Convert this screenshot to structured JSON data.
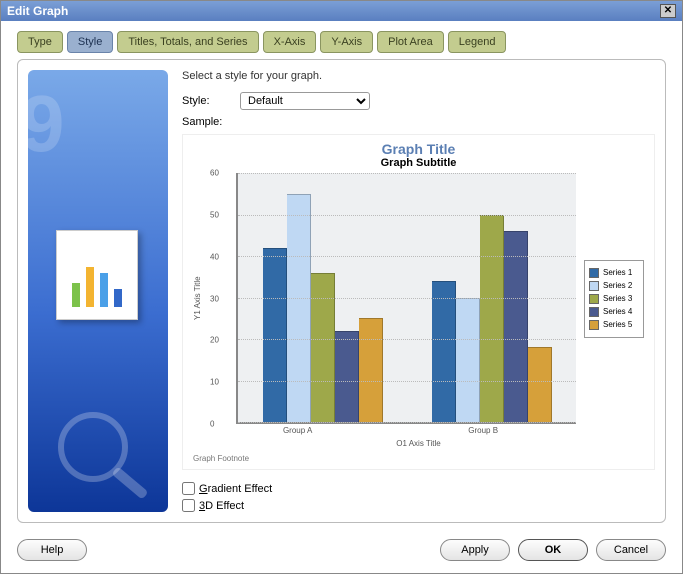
{
  "window": {
    "title": "Edit Graph"
  },
  "tabs": [
    {
      "label": "Type"
    },
    {
      "label": "Style"
    },
    {
      "label": "Titles, Totals, and Series"
    },
    {
      "label": "X-Axis"
    },
    {
      "label": "Y-Axis"
    },
    {
      "label": "Plot Area"
    },
    {
      "label": "Legend"
    }
  ],
  "active_tab_index": 1,
  "instruction": "Select a style for your graph.",
  "style_label": "Style:",
  "style_value": "Default",
  "sample_label": "Sample:",
  "checkboxes": {
    "gradient": "Gradient Effect",
    "threeD": "3D Effect"
  },
  "buttons": {
    "help": "Help",
    "apply": "Apply",
    "ok": "OK",
    "cancel": "Cancel"
  },
  "chart_data": {
    "type": "bar",
    "title": "Graph Title",
    "subtitle": "Graph Subtitle",
    "xlabel": "O1 Axis Title",
    "ylabel": "Y1 Axis Title",
    "footnote": "Graph Footnote",
    "ylim": [
      0,
      60
    ],
    "yticks": [
      0,
      10,
      20,
      30,
      40,
      50,
      60
    ],
    "categories": [
      "Group A",
      "Group B"
    ],
    "series": [
      {
        "name": "Series 1",
        "color": "#316aa6",
        "values": [
          42,
          34
        ]
      },
      {
        "name": "Series 2",
        "color": "#bfd8f3",
        "values": [
          55,
          30
        ]
      },
      {
        "name": "Series 3",
        "color": "#9ea84a",
        "values": [
          36,
          50
        ]
      },
      {
        "name": "Series 4",
        "color": "#4a5a8f",
        "values": [
          22,
          46
        ]
      },
      {
        "name": "Series 5",
        "color": "#d6a03a",
        "values": [
          25,
          18
        ]
      }
    ]
  }
}
